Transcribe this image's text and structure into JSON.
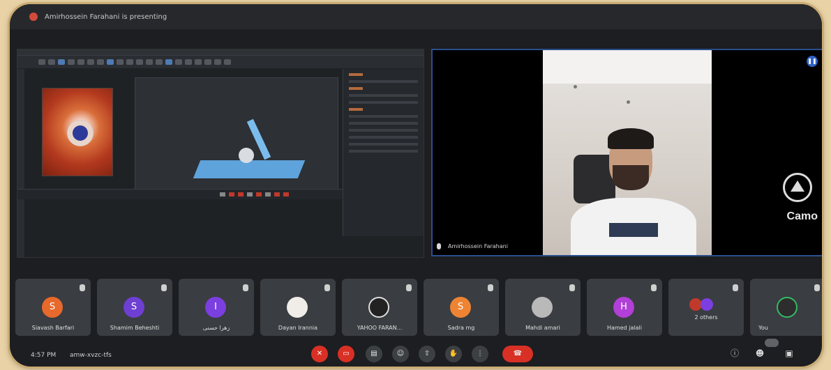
{
  "topbar": {
    "presenting_text": "Amirhossein Farahani is presenting"
  },
  "speaker": {
    "name": "Amirhossein Farahani",
    "watermark": "Camo"
  },
  "participants": [
    {
      "name": "Siavash Barfari",
      "initial": "S",
      "color": "#e8692c"
    },
    {
      "name": "Shamim Beheshti",
      "initial": "S",
      "color": "#6e3fd3"
    },
    {
      "name": "زهرا حسنی",
      "initial": "I",
      "color": "#7b3fe0"
    },
    {
      "name": "Dayan Irannia",
      "initial": "",
      "color": "#f0ede9"
    },
    {
      "name": "YAHOO FARAN...",
      "initial": "",
      "color": "#222"
    },
    {
      "name": "Sadra mg",
      "initial": "S",
      "color": "#ee8433"
    },
    {
      "name": "Mahdi amari",
      "initial": "",
      "color": "#b9b9b9"
    },
    {
      "name": "Hamed jalali",
      "initial": "H",
      "color": "#b13fd8"
    },
    {
      "name": "2 others",
      "initial": "",
      "color": "#c0392b"
    },
    {
      "name": "You",
      "initial": "",
      "color": "#2d2d2d"
    }
  ],
  "bottombar": {
    "time": "4:57 PM",
    "meeting_code": "amw-xvzc-tfs",
    "controls": [
      "mic-off",
      "cam-off",
      "captions",
      "emoji",
      "present",
      "raise-hand",
      "more",
      "end-call"
    ]
  }
}
